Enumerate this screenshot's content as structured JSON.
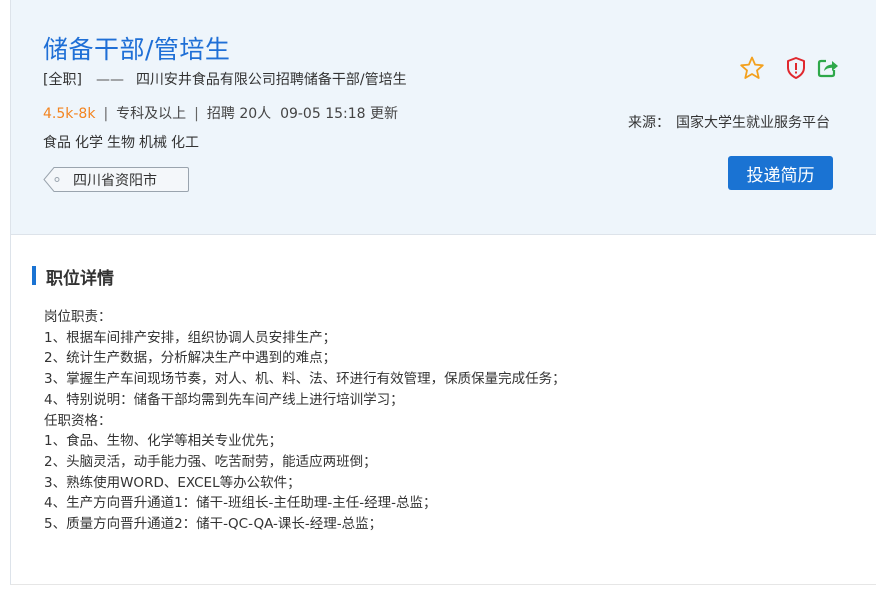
{
  "job": {
    "title": "储备干部/管培生",
    "type_tag": "[全职]",
    "dash": "——",
    "company_line": "四川安井食品有限公司招聘储备干部/管培生",
    "salary": "4.5k-8k",
    "separator": "|",
    "education": "专科及以上",
    "headcount": "招聘 20人",
    "updated": "09-05 15:18 更新",
    "tags": [
      "食品",
      "化学",
      "生物",
      "机械",
      "化工"
    ],
    "location": "四川省资阳市",
    "source_label": "来源：",
    "source_value": "国家大学生就业服务平台",
    "apply_label": "投递简历"
  },
  "icons": {
    "favorite": "star-icon",
    "report": "shield-icon",
    "share": "share-icon",
    "colors": {
      "star": "#f3a11f",
      "shield": "#e0282e",
      "share": "#2ea84a",
      "accent": "#1a73d3",
      "title": "#1f6fd6",
      "salary": "#f3841f"
    }
  },
  "details": {
    "section_title": "职位详情",
    "lines": [
      "岗位职责：",
      "1、根据车间排产安排，组织协调人员安排生产；",
      "2、统计生产数据，分析解决生产中遇到的难点；",
      "3、掌握生产车间现场节奏，对人、机、料、法、环进行有效管理，保质保量完成任务；",
      "4、特别说明：储备干部均需到先车间产线上进行培训学习；",
      "任职资格：",
      "1、食品、生物、化学等相关专业优先；",
      "2、头脑灵活，动手能力强、吃苦耐劳，能适应两班倒；",
      "3、熟练使用WORD、EXCEL等办公软件；",
      "4、生产方向晋升通道1：储干-班组长-主任助理-主任-经理-总监；",
      "5、质量方向晋升通道2：储干-QC-QA-课长-经理-总监；"
    ]
  }
}
